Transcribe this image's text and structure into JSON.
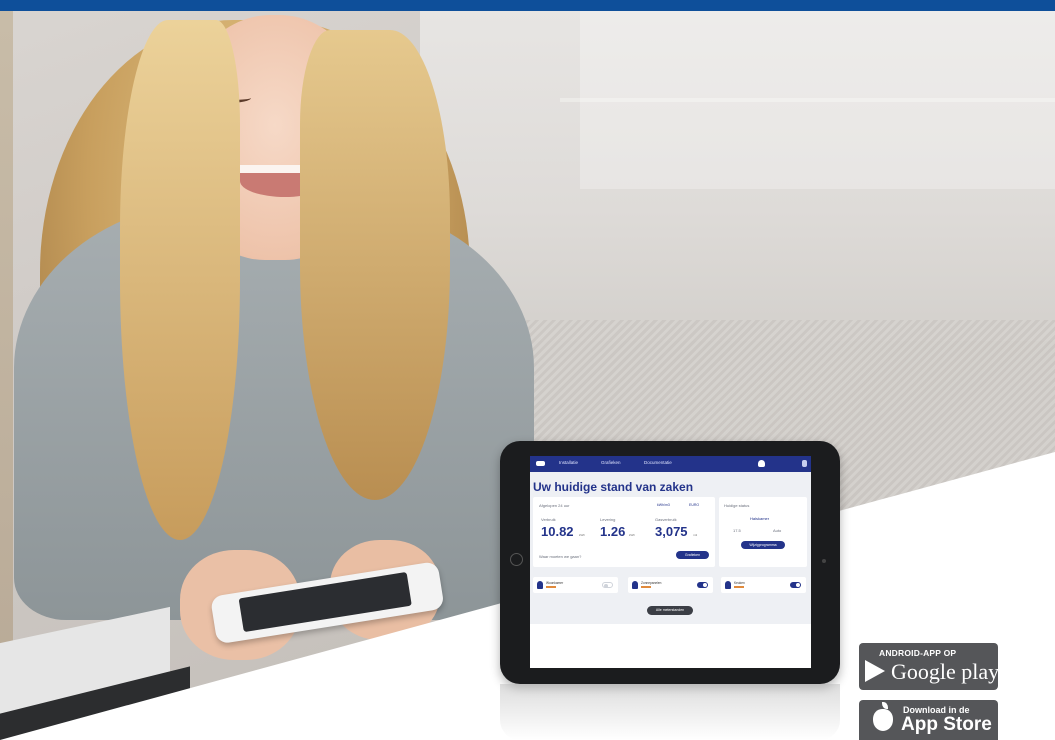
{
  "colors": {
    "brand_blue": "#0e4f9a",
    "app_blue": "#23338a",
    "badge_grey": "#555659"
  },
  "tablet": {
    "nav": {
      "items": [
        "Installatie",
        "Grafieken",
        "Documentatie"
      ]
    },
    "heading": "Uw huidige stand van zaken",
    "summary": {
      "period_label": "Afgelopen 24 uur",
      "unit_options": [
        "kWh/m3",
        "EURO"
      ],
      "metrics": [
        {
          "label": "Verbruik",
          "value": "10.82",
          "unit": "kWh"
        },
        {
          "label": "Levering",
          "value": "1.26",
          "unit": "kWh"
        },
        {
          "label": "Gasverbruik",
          "value": "3,075",
          "unit": "m3"
        }
      ],
      "question": "Waar moeten we gaan?",
      "graphs_button": "Grafieken"
    },
    "side_card": {
      "title": "Huidige status",
      "subtitle": "Halskamer",
      "readings": [
        "17.5",
        "Auto"
      ],
      "button": "Wijzigprogramma"
    },
    "rows": [
      {
        "name": "Woonkamer",
        "on": false
      },
      {
        "name": "Zonnepanelen",
        "on": true
      },
      {
        "name": "Keuken",
        "on": true
      }
    ],
    "all_button": "Alle meterstanden"
  },
  "badges": {
    "google": {
      "small": "ANDROID-APP OP",
      "big": "Google play",
      "icon": "play-triangle-icon"
    },
    "apple": {
      "small": "Download in de",
      "big": "App Store",
      "icon": "apple-icon"
    }
  }
}
